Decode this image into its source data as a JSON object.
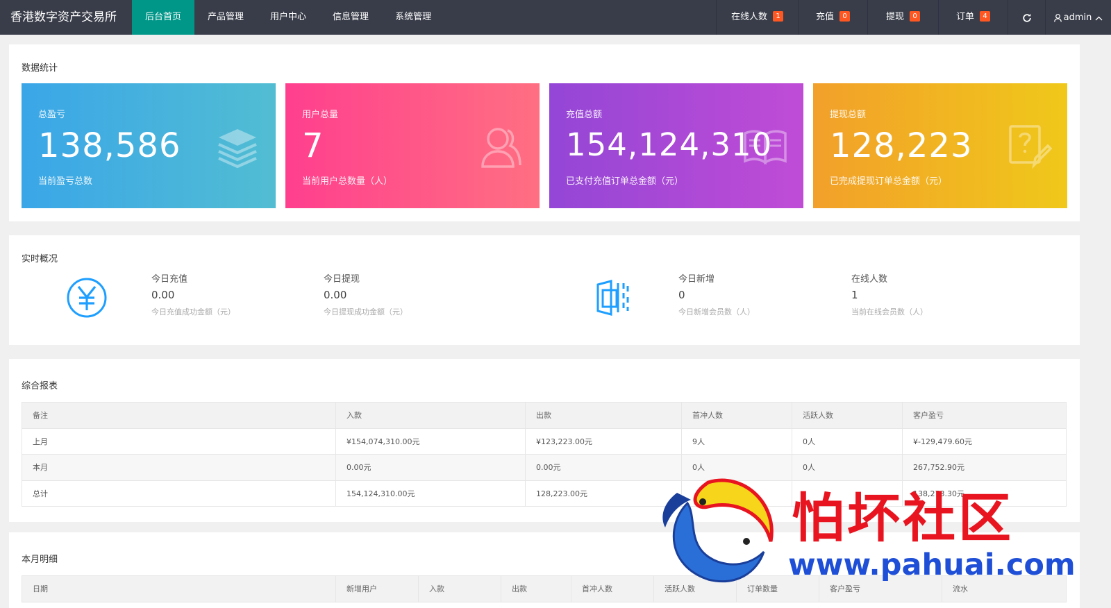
{
  "header": {
    "logo": "香港数字资产交易所",
    "nav": [
      "后台首页",
      "产品管理",
      "用户中心",
      "信息管理",
      "系统管理"
    ],
    "right": [
      {
        "label": "在线人数",
        "badge": "1"
      },
      {
        "label": "充值",
        "badge": "0"
      },
      {
        "label": "提现",
        "badge": "0"
      },
      {
        "label": "订单",
        "badge": "4"
      }
    ],
    "user": "admin"
  },
  "stats": {
    "title": "数据统计",
    "cards": [
      {
        "label": "总盈亏",
        "value": "138,586",
        "desc": "当前盈亏总数",
        "icon": "layers-icon",
        "color": "#40a9ea"
      },
      {
        "label": "用户总量",
        "value": "7",
        "desc": "当前用户总数量（人）",
        "icon": "users-icon",
        "color": "#ff4a8d"
      },
      {
        "label": "充值总额",
        "value": "154,124,310",
        "desc": "已支付充值订单总金额（元）",
        "icon": "book-icon",
        "color": "#9c4ed8"
      },
      {
        "label": "提现总额",
        "value": "128,223",
        "desc": "已完成提现订单总金额（元）",
        "icon": "help-edit-icon",
        "color": "#f3a51d"
      }
    ]
  },
  "realtime": {
    "title": "实时概况",
    "items": [
      {
        "label": "今日充值",
        "value": "0.00",
        "desc": "今日充值成功金额（元）"
      },
      {
        "label": "今日提现",
        "value": "0.00",
        "desc": "今日提现成功金额（元）"
      },
      {
        "label": "今日新增",
        "value": "0",
        "desc": "今日新增会员数（人）"
      },
      {
        "label": "在线人数",
        "value": "1",
        "desc": "当前在线会员数（人）"
      }
    ]
  },
  "report": {
    "title": "综合报表",
    "headers": [
      "备注",
      "入款",
      "出款",
      "首冲人数",
      "活跃人数",
      "客户盈亏"
    ],
    "rows": [
      [
        "上月",
        "¥154,074,310.00元",
        "¥123,223.00元",
        "9人",
        "0人",
        "¥-129,479.60元"
      ],
      [
        "本月",
        "0.00元",
        "0.00元",
        "0人",
        "0人",
        "267,752.90元"
      ],
      [
        "总计",
        "154,124,310.00元",
        "128,223.00元",
        "",
        "",
        "138,273.30元"
      ]
    ]
  },
  "monthly": {
    "title": "本月明细",
    "headers": [
      "日期",
      "新增用户",
      "入款",
      "出款",
      "首冲人数",
      "活跃人数",
      "订单数量",
      "客户盈亏",
      "流水"
    ]
  },
  "watermark": {
    "text": "怕坏社区",
    "url": "www.pahuai.com"
  }
}
